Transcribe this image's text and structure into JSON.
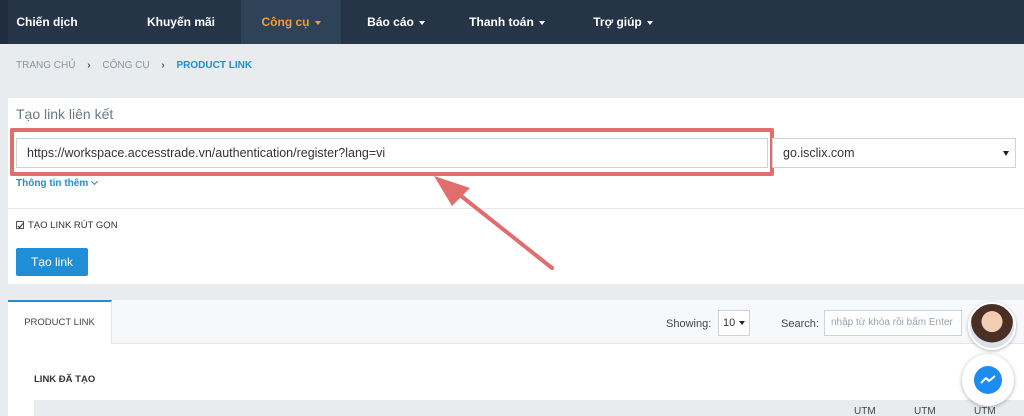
{
  "nav": {
    "items": [
      {
        "label": "Chiến dịch",
        "dropdown": false
      },
      {
        "label": "Khuyến mãi",
        "dropdown": false
      },
      {
        "label": "Công cụ",
        "dropdown": true,
        "active": true
      },
      {
        "label": "Báo cáo",
        "dropdown": true
      },
      {
        "label": "Thanh toán",
        "dropdown": true
      },
      {
        "label": "Trợ giúp",
        "dropdown": true
      }
    ]
  },
  "breadcrumb": {
    "home": "TRANG CHỦ",
    "tools": "CÔNG CỤ",
    "current": "PRODUCT LINK"
  },
  "form": {
    "title": "Tạo link liên kết",
    "url_value": "https://workspace.accesstrade.vn/authentication/register?lang=vi",
    "domain_value": "go.isclix.com",
    "more_info": "Thông tin thêm",
    "shortlink_label": "TẠO LINK RÚT GỌN",
    "shortlink_checked": true,
    "create_button": "Tạo link"
  },
  "table": {
    "tab_label": "PRODUCT LINK",
    "showing_label": "Showing:",
    "showing_value": "10",
    "search_label": "Search:",
    "search_placeholder": "nhập từ khóa rồi bấm Enter",
    "section_title": "LINK ĐÃ TẠO",
    "utm_headers": [
      "UTM",
      "UTM",
      "UTM"
    ]
  },
  "colors": {
    "accent": "#1f8ed6",
    "nav_active": "#f39c2d",
    "highlight": "#e26d6d",
    "nav_bg": "#253547"
  },
  "icons": {
    "messenger": "messenger-icon",
    "avatar": "support-avatar"
  }
}
